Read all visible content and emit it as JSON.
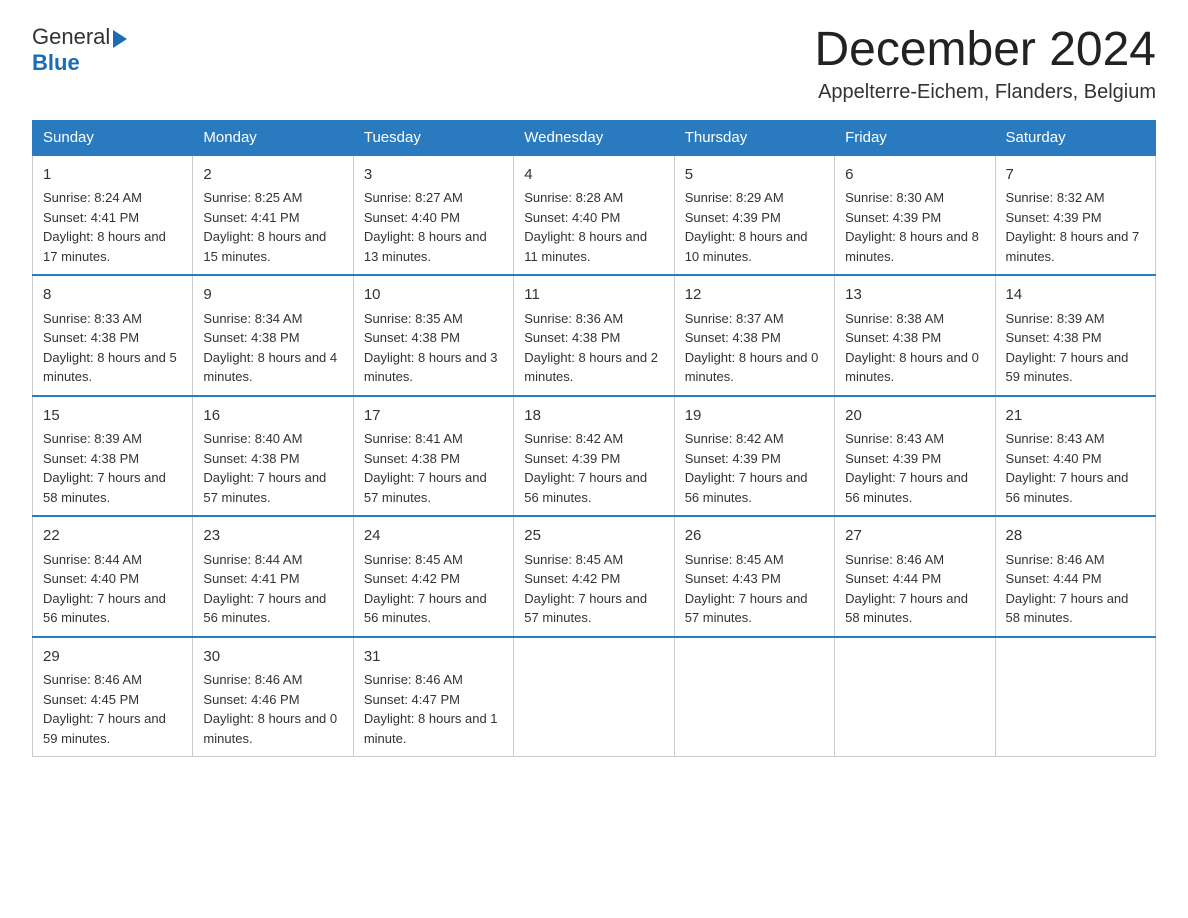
{
  "logo": {
    "text1": "General",
    "text2": "Blue"
  },
  "title": "December 2024",
  "subtitle": "Appelterre-Eichem, Flanders, Belgium",
  "days_of_week": [
    "Sunday",
    "Monday",
    "Tuesday",
    "Wednesday",
    "Thursday",
    "Friday",
    "Saturday"
  ],
  "weeks": [
    [
      {
        "day": "1",
        "sunrise": "8:24 AM",
        "sunset": "4:41 PM",
        "daylight": "8 hours and 17 minutes."
      },
      {
        "day": "2",
        "sunrise": "8:25 AM",
        "sunset": "4:41 PM",
        "daylight": "8 hours and 15 minutes."
      },
      {
        "day": "3",
        "sunrise": "8:27 AM",
        "sunset": "4:40 PM",
        "daylight": "8 hours and 13 minutes."
      },
      {
        "day": "4",
        "sunrise": "8:28 AM",
        "sunset": "4:40 PM",
        "daylight": "8 hours and 11 minutes."
      },
      {
        "day": "5",
        "sunrise": "8:29 AM",
        "sunset": "4:39 PM",
        "daylight": "8 hours and 10 minutes."
      },
      {
        "day": "6",
        "sunrise": "8:30 AM",
        "sunset": "4:39 PM",
        "daylight": "8 hours and 8 minutes."
      },
      {
        "day": "7",
        "sunrise": "8:32 AM",
        "sunset": "4:39 PM",
        "daylight": "8 hours and 7 minutes."
      }
    ],
    [
      {
        "day": "8",
        "sunrise": "8:33 AM",
        "sunset": "4:38 PM",
        "daylight": "8 hours and 5 minutes."
      },
      {
        "day": "9",
        "sunrise": "8:34 AM",
        "sunset": "4:38 PM",
        "daylight": "8 hours and 4 minutes."
      },
      {
        "day": "10",
        "sunrise": "8:35 AM",
        "sunset": "4:38 PM",
        "daylight": "8 hours and 3 minutes."
      },
      {
        "day": "11",
        "sunrise": "8:36 AM",
        "sunset": "4:38 PM",
        "daylight": "8 hours and 2 minutes."
      },
      {
        "day": "12",
        "sunrise": "8:37 AM",
        "sunset": "4:38 PM",
        "daylight": "8 hours and 0 minutes."
      },
      {
        "day": "13",
        "sunrise": "8:38 AM",
        "sunset": "4:38 PM",
        "daylight": "8 hours and 0 minutes."
      },
      {
        "day": "14",
        "sunrise": "8:39 AM",
        "sunset": "4:38 PM",
        "daylight": "7 hours and 59 minutes."
      }
    ],
    [
      {
        "day": "15",
        "sunrise": "8:39 AM",
        "sunset": "4:38 PM",
        "daylight": "7 hours and 58 minutes."
      },
      {
        "day": "16",
        "sunrise": "8:40 AM",
        "sunset": "4:38 PM",
        "daylight": "7 hours and 57 minutes."
      },
      {
        "day": "17",
        "sunrise": "8:41 AM",
        "sunset": "4:38 PM",
        "daylight": "7 hours and 57 minutes."
      },
      {
        "day": "18",
        "sunrise": "8:42 AM",
        "sunset": "4:39 PM",
        "daylight": "7 hours and 56 minutes."
      },
      {
        "day": "19",
        "sunrise": "8:42 AM",
        "sunset": "4:39 PM",
        "daylight": "7 hours and 56 minutes."
      },
      {
        "day": "20",
        "sunrise": "8:43 AM",
        "sunset": "4:39 PM",
        "daylight": "7 hours and 56 minutes."
      },
      {
        "day": "21",
        "sunrise": "8:43 AM",
        "sunset": "4:40 PM",
        "daylight": "7 hours and 56 minutes."
      }
    ],
    [
      {
        "day": "22",
        "sunrise": "8:44 AM",
        "sunset": "4:40 PM",
        "daylight": "7 hours and 56 minutes."
      },
      {
        "day": "23",
        "sunrise": "8:44 AM",
        "sunset": "4:41 PM",
        "daylight": "7 hours and 56 minutes."
      },
      {
        "day": "24",
        "sunrise": "8:45 AM",
        "sunset": "4:42 PM",
        "daylight": "7 hours and 56 minutes."
      },
      {
        "day": "25",
        "sunrise": "8:45 AM",
        "sunset": "4:42 PM",
        "daylight": "7 hours and 57 minutes."
      },
      {
        "day": "26",
        "sunrise": "8:45 AM",
        "sunset": "4:43 PM",
        "daylight": "7 hours and 57 minutes."
      },
      {
        "day": "27",
        "sunrise": "8:46 AM",
        "sunset": "4:44 PM",
        "daylight": "7 hours and 58 minutes."
      },
      {
        "day": "28",
        "sunrise": "8:46 AM",
        "sunset": "4:44 PM",
        "daylight": "7 hours and 58 minutes."
      }
    ],
    [
      {
        "day": "29",
        "sunrise": "8:46 AM",
        "sunset": "4:45 PM",
        "daylight": "7 hours and 59 minutes."
      },
      {
        "day": "30",
        "sunrise": "8:46 AM",
        "sunset": "4:46 PM",
        "daylight": "8 hours and 0 minutes."
      },
      {
        "day": "31",
        "sunrise": "8:46 AM",
        "sunset": "4:47 PM",
        "daylight": "8 hours and 1 minute."
      },
      null,
      null,
      null,
      null
    ]
  ]
}
